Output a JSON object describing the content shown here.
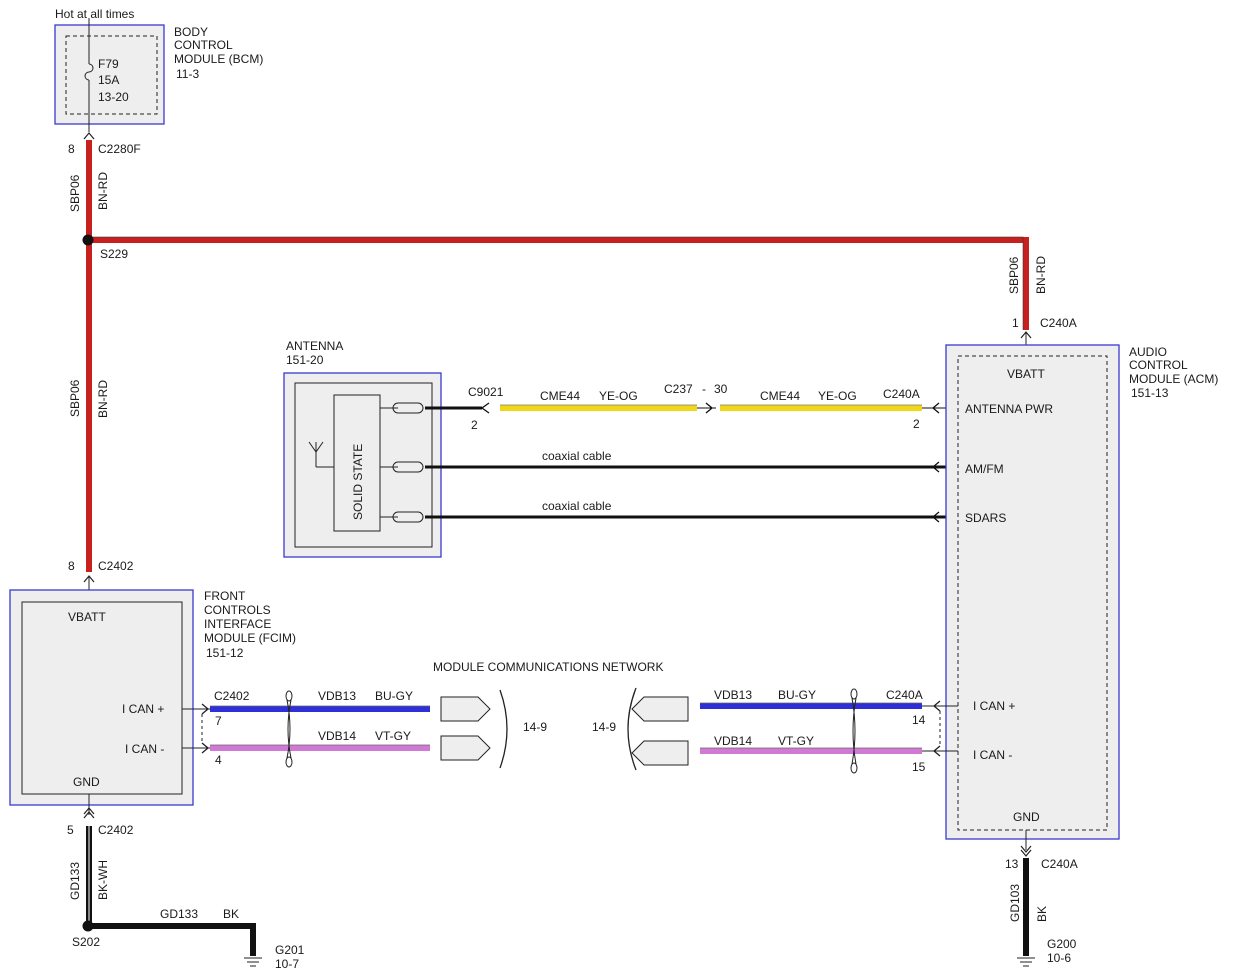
{
  "colors": {
    "wire_red": "#c8201f",
    "wire_yellow": "#f0d818",
    "wire_blue": "#2f2fd8",
    "wire_violet": "#d07ad6",
    "wire_black": "#111111",
    "frame_blue": "#3a3ad0",
    "module_fill": "#eeeeee"
  },
  "bcm": {
    "hot_label": "Hot at all times",
    "fuse_id": "F79",
    "fuse_rating": "15A",
    "fuse_ref": "13-20",
    "name_line1": "BODY",
    "name_line2": "CONTROL",
    "name_line3": "MODULE (BCM)",
    "ref": "11-3",
    "pin": "8",
    "connector": "C2280F"
  },
  "splice_s229": {
    "label": "S229",
    "wire_upper_circuit": "SBP06",
    "wire_upper_color": "BN-RD",
    "wire_lower_circuit": "SBP06",
    "wire_lower_color": "BN-RD",
    "wire_right_circuit": "SBP06",
    "wire_right_color": "BN-RD"
  },
  "fcim": {
    "name_line1": "FRONT",
    "name_line2": "CONTROLS",
    "name_line3": "INTERFACE",
    "name_line4": "MODULE (FCIM)",
    "ref": "151-12",
    "vbatt_label": "VBATT",
    "vbatt_pin": "8",
    "vbatt_connector": "C2402",
    "ican_plus_label": "I CAN +",
    "ican_minus_label": "I CAN -",
    "gnd_label": "GND",
    "can_connector": "C2402",
    "can_plus_pin": "7",
    "can_minus_pin": "4",
    "gnd_pin": "5",
    "gnd_connector": "C2402",
    "gnd_circuit": "GD133",
    "gnd_color": "BK-WH",
    "splice_label": "S202",
    "ground_wire_circuit": "GD133",
    "ground_wire_color": "BK",
    "ground_label": "G201",
    "ground_ref": "10-7"
  },
  "antenna": {
    "name": "ANTENNA",
    "ref": "151-20",
    "inner_label": "SOLID STATE",
    "connector": "C9021",
    "pin": "2"
  },
  "wires": {
    "pwr_left_circuit": "CME44",
    "pwr_left_color": "YE-OG",
    "inline_connector": "C237",
    "inline_dash": "-",
    "inline_pin": "30",
    "pwr_right_circuit": "CME44",
    "pwr_right_color": "YE-OG",
    "coax1_label": "coaxial cable",
    "coax2_label": "coaxial cable",
    "network_title": "MODULE COMMUNICATIONS NETWORK",
    "left_ref": "14-9",
    "right_ref": "14-9",
    "fcim_canp_circuit": "VDB13",
    "fcim_canp_color": "BU-GY",
    "fcim_canm_circuit": "VDB14",
    "fcim_canm_color": "VT-GY",
    "acm_canp_circuit": "VDB13",
    "acm_canp_color": "BU-GY",
    "acm_canm_circuit": "VDB14",
    "acm_canm_color": "VT-GY"
  },
  "acm": {
    "name_line1": "AUDIO",
    "name_line2": "CONTROL",
    "name_line3": "MODULE (ACM)",
    "ref": "151-13",
    "vbatt_label": "VBATT",
    "vbatt_pin": "1",
    "vbatt_connector": "C240A",
    "antenna_pwr_label": "ANTENNA PWR",
    "antenna_pwr_connector": "C240A",
    "antenna_pwr_pin": "2",
    "amfm_label": "AM/FM",
    "sdars_label": "SDARS",
    "ican_plus_label": "I CAN +",
    "ican_minus_label": "I CAN -",
    "can_connector": "C240A",
    "can_plus_pin": "14",
    "can_minus_pin": "15",
    "gnd_label": "GND",
    "gnd_pin": "13",
    "gnd_connector": "C240A",
    "gnd_circuit": "GD103",
    "gnd_color": "BK",
    "ground_label": "G200",
    "ground_ref": "10-6"
  }
}
